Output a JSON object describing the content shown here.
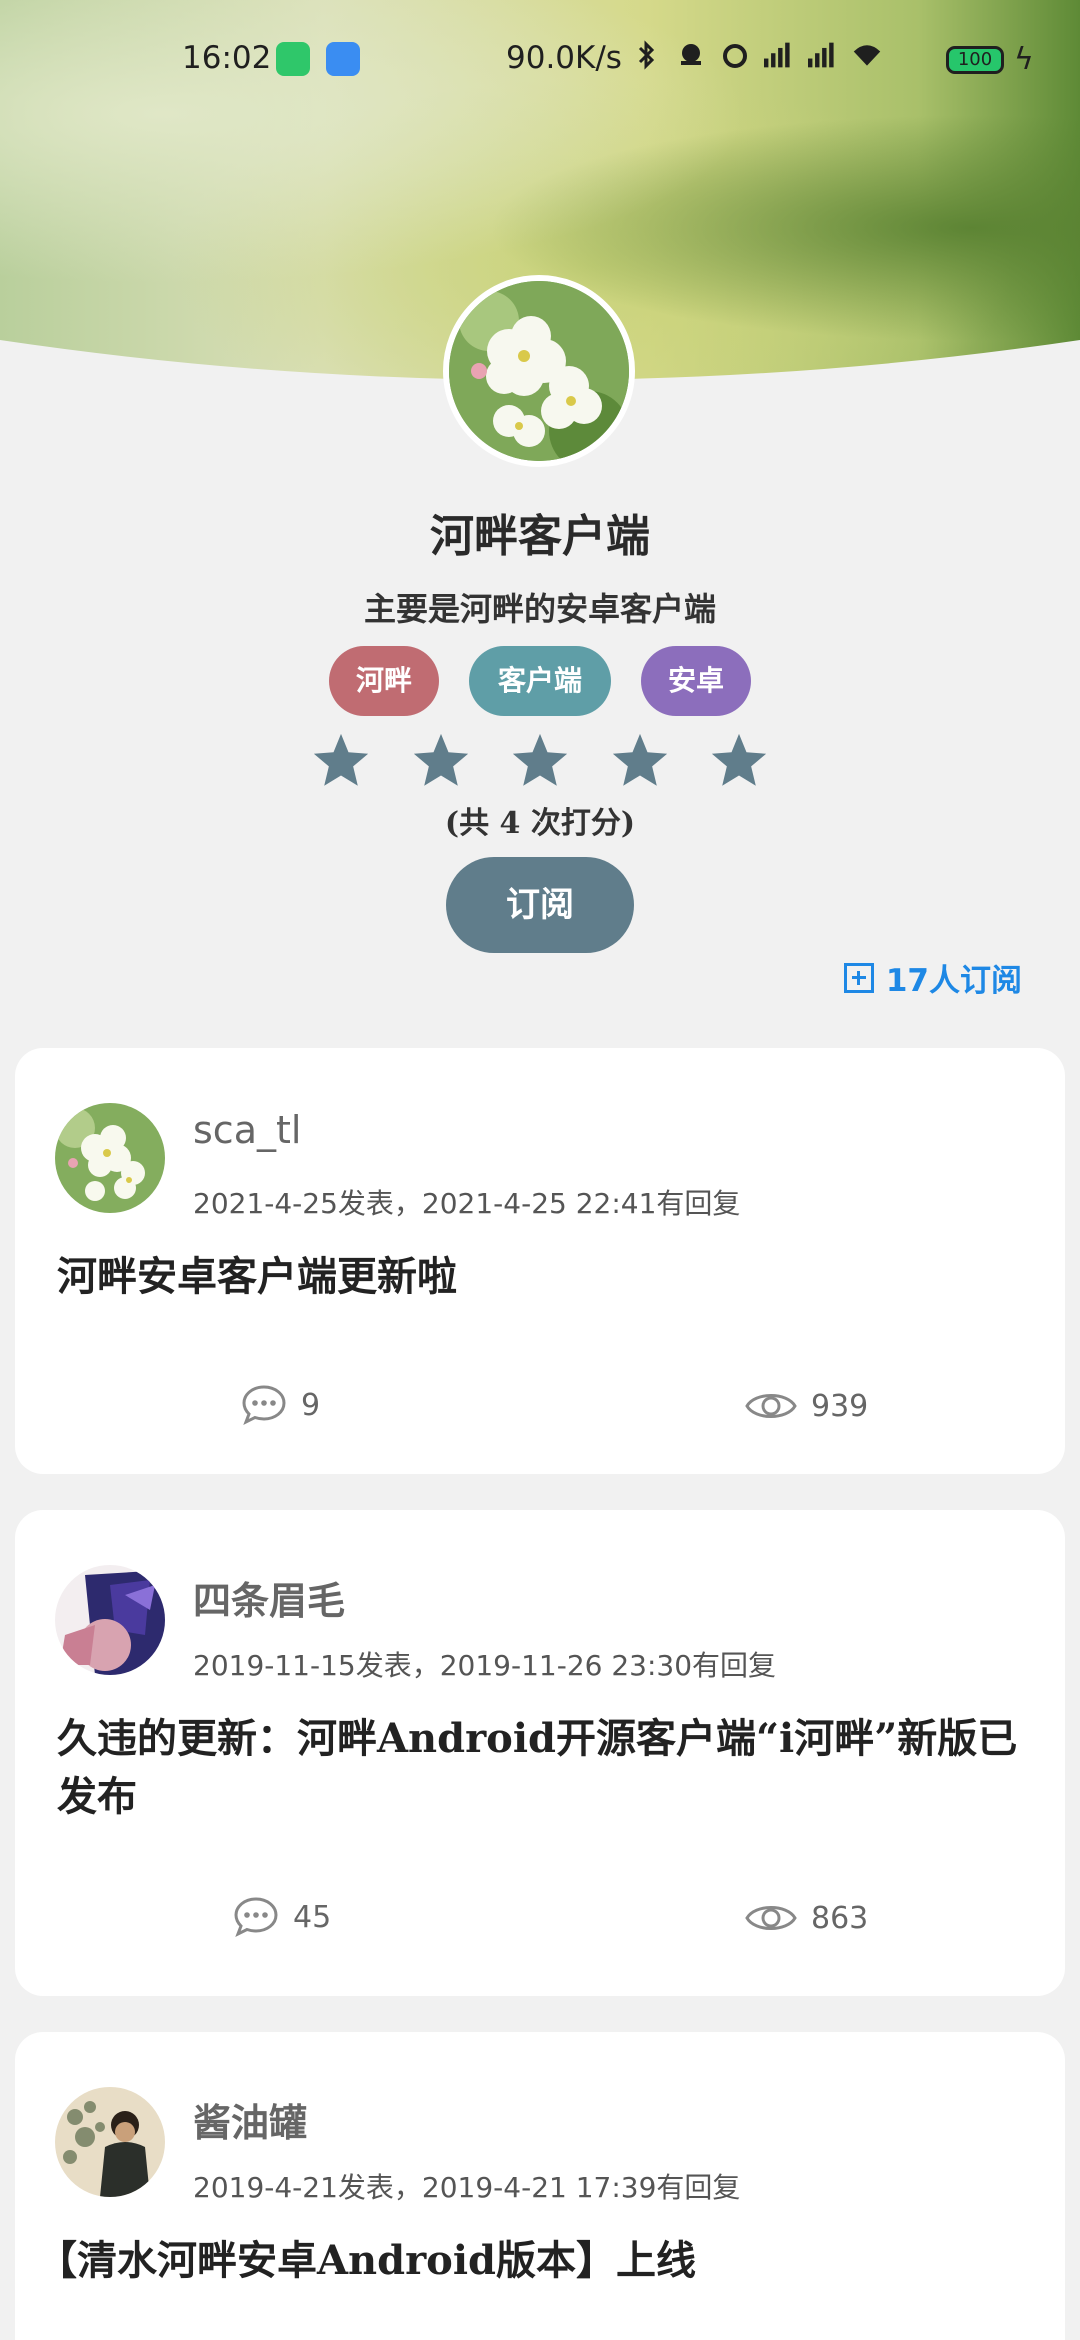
{
  "status_bar": {
    "time": "16:02",
    "speed": "90.0K/s",
    "battery": "100"
  },
  "header": {
    "app_name": "河畔客户端",
    "description": "主要是河畔的安卓客户端",
    "tags": [
      "河畔",
      "客户端",
      "安卓"
    ],
    "tag_colors": [
      "#c06c72",
      "#5f9ea7",
      "#8c6ebc"
    ],
    "rating": 5,
    "rating_max": 5,
    "rating_count_text": "(共 4 次打分)",
    "subscribe_label": "订阅",
    "subscriber_text": "17人订阅"
  },
  "posts": [
    {
      "user": "sca_tl",
      "meta": "2021-4-25发表，2021-4-25 22:41有回复",
      "title": "河畔安卓客户端更新啦",
      "comments": "9",
      "views": "939"
    },
    {
      "user": "四条眉毛",
      "meta": "2019-11-15发表，2019-11-26 23:30有回复",
      "title": "久违的更新：河畔Android开源客户端“i河畔”新版已发布",
      "comments": "45",
      "views": "863"
    },
    {
      "user": "酱油罐",
      "meta": "2019-4-21发表，2019-4-21 17:39有回复",
      "title": "【清水河畔安卓Android版本】上线"
    }
  ],
  "colors": {
    "accent": "#607d8b",
    "link": "#1e88e5",
    "background": "#f1f1f1"
  }
}
